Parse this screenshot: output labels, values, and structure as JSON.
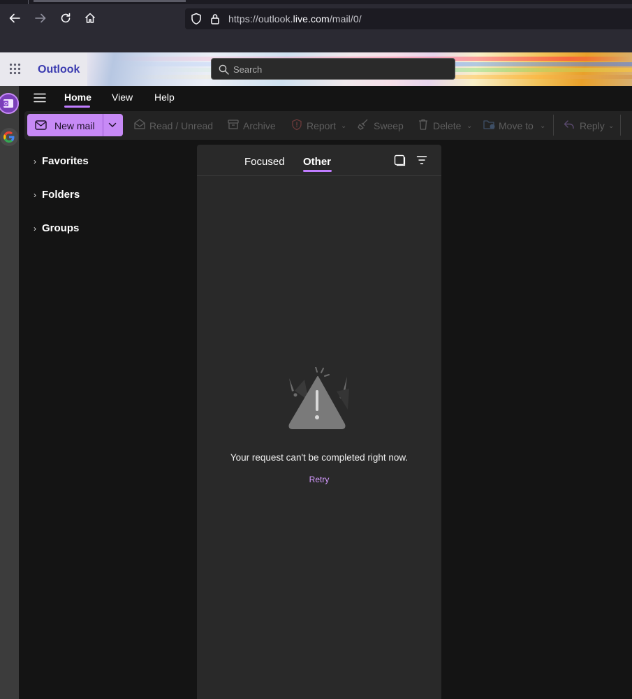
{
  "browser": {
    "url_prefix": "https://outlook.",
    "url_domain": "live.com",
    "url_suffix": "/mail/0/"
  },
  "header": {
    "brand": "Outlook",
    "search_placeholder": "Search"
  },
  "ribbon": {
    "tabs": [
      "Home",
      "View",
      "Help"
    ],
    "active_tab": "Home"
  },
  "toolbar": {
    "new_mail": "New mail",
    "read_unread": "Read / Unread",
    "archive": "Archive",
    "report": "Report",
    "sweep": "Sweep",
    "delete": "Delete",
    "move_to": "Move to",
    "reply": "Reply"
  },
  "folders": [
    "Favorites",
    "Folders",
    "Groups"
  ],
  "message_list": {
    "tabs": [
      "Focused",
      "Other"
    ],
    "active_tab": "Other",
    "error_message": "Your request can't be completed right now.",
    "retry_label": "Retry"
  },
  "colors": {
    "accent": "#c07dff",
    "new_mail_bg": "#c78af6",
    "brand_text": "#3b3bb0"
  }
}
